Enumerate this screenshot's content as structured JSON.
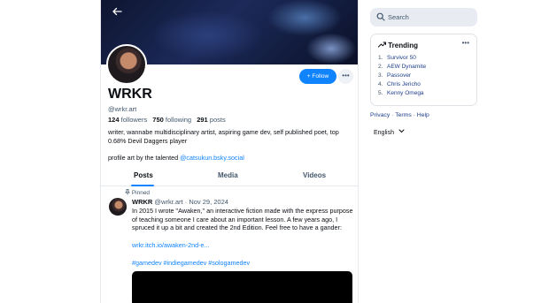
{
  "profile": {
    "display_name": "WRKR",
    "handle": "@wrkr.art",
    "follow_label": "+ Follow",
    "more_label": "•••",
    "stats": {
      "followers_count": "124",
      "followers_label": "followers",
      "following_count": "750",
      "following_label": "following",
      "posts_count": "291",
      "posts_label": "posts"
    },
    "bio_line1": "writer, wannabe multidisciplinary artist, aspiring game dev, self published poet, top 0.68% Devil Daggers player",
    "bio_line2_prefix": "profile art by the talented",
    "bio_line2_link": "@catsukun.bsky.social"
  },
  "nav": {
    "back_icon": "arrow-left-icon"
  },
  "tabs": [
    {
      "label": "Posts",
      "active": true
    },
    {
      "label": "Media",
      "active": false
    },
    {
      "label": "Videos",
      "active": false
    }
  ],
  "post": {
    "pinned_label": "Pinned",
    "author_name": "WRKR",
    "author_handle": "@wrkr.art",
    "separator": "·",
    "date": "Nov 29, 2024",
    "body": "In 2015 I wrote \"Awaken,\" an interactive fiction made with the express purpose of teaching someone I care about an important lesson. A few years ago, I spruced it up a bit and created the 2nd Edition. Feel free to have a gander:",
    "link": "wrkr.itch.io/awaken-2nd-e...",
    "tags": "#gamedev #indiegamedev #sologamedev"
  },
  "sidebar": {
    "search_placeholder": "Search",
    "trending_title": "Trending",
    "trending_more": "•••",
    "trending": [
      {
        "num": "1.",
        "label": "Survivor 50"
      },
      {
        "num": "2.",
        "label": "AEW Dynamite"
      },
      {
        "num": "3.",
        "label": "Passover"
      },
      {
        "num": "4.",
        "label": "Chris Jericho"
      },
      {
        "num": "5.",
        "label": "Kenny Omega"
      }
    ],
    "footer": {
      "privacy": "Privacy",
      "terms": "Terms",
      "help": "Help",
      "sep": "·"
    },
    "language": "English"
  },
  "colors": {
    "accent": "#1083fe",
    "muted": "#42576c",
    "trend_link": "#1d3e8a"
  }
}
